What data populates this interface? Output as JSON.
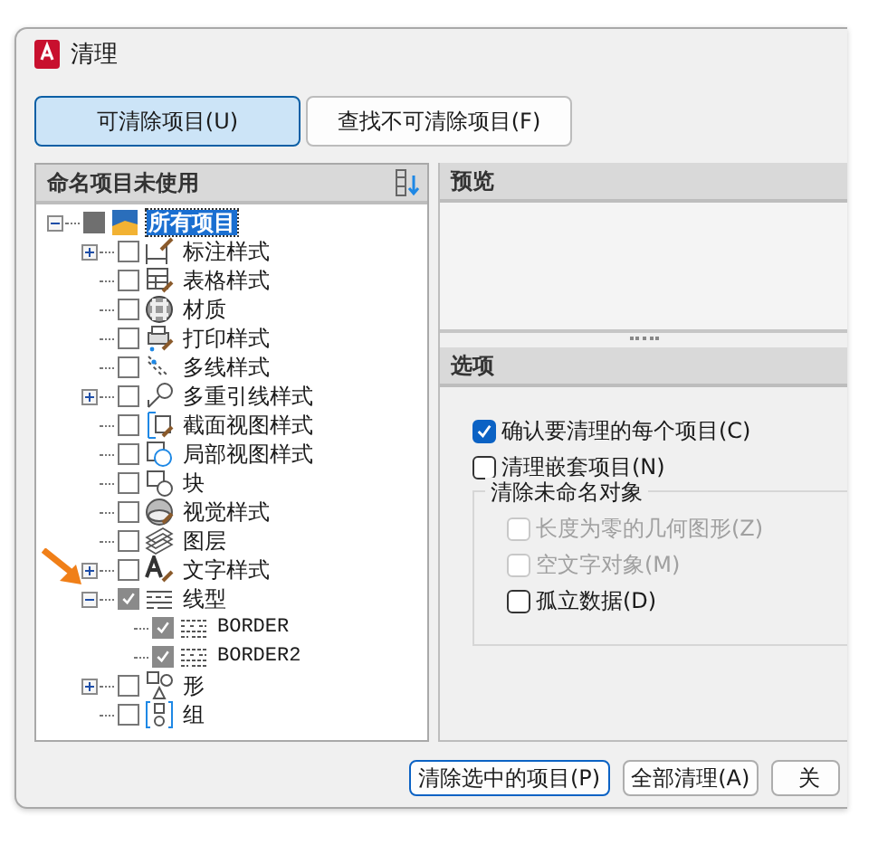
{
  "window": {
    "title": "清理"
  },
  "tabs": [
    {
      "label": "可清除项目(U)",
      "selected": true
    },
    {
      "label": "查找不可清除项目(F)",
      "selected": false
    }
  ],
  "tree": {
    "header": "命名项目未使用",
    "items": [
      {
        "label": "所有项目",
        "checked": false,
        "partial": true,
        "selected": true,
        "expanded": true,
        "children": [
          {
            "label": "标注样式",
            "checked": false,
            "selected": false,
            "expanded": false
          },
          {
            "label": "表格样式",
            "checked": false,
            "selected": false
          },
          {
            "label": "材质",
            "checked": false,
            "selected": false
          },
          {
            "label": "打印样式",
            "checked": false,
            "selected": false
          },
          {
            "label": "多线样式",
            "checked": false,
            "selected": false
          },
          {
            "label": "多重引线样式",
            "checked": false,
            "selected": false,
            "expanded": false
          },
          {
            "label": "截面视图样式",
            "checked": false,
            "selected": false
          },
          {
            "label": "局部视图样式",
            "checked": false,
            "selected": false
          },
          {
            "label": "块",
            "checked": false,
            "selected": false
          },
          {
            "label": "视觉样式",
            "checked": false,
            "selected": false
          },
          {
            "label": "图层",
            "checked": false,
            "selected": false
          },
          {
            "label": "文字样式",
            "checked": false,
            "selected": false,
            "expanded": false
          },
          {
            "label": "线型",
            "checked": true,
            "selected": false,
            "expanded": true,
            "children": [
              {
                "label": "BORDER",
                "checked": true,
                "selected": false
              },
              {
                "label": "BORDER2",
                "checked": true,
                "selected": false
              }
            ]
          },
          {
            "label": "形",
            "checked": false,
            "selected": false,
            "expanded": false
          },
          {
            "label": "组",
            "checked": false,
            "selected": false
          }
        ]
      }
    ]
  },
  "preview": {
    "header": "预览"
  },
  "options": {
    "header": "选项",
    "checks": [
      {
        "label": "确认要清理的每个项目(C)",
        "checked": true,
        "disabled": false
      },
      {
        "label": "清理嵌套项目(N)",
        "checked": false,
        "disabled": false
      }
    ],
    "group": {
      "title": "清除未命名对象",
      "checks": [
        {
          "label": "长度为零的几何图形(Z)",
          "checked": false,
          "disabled": true
        },
        {
          "label": "空文字对象(M)",
          "checked": false,
          "disabled": true
        },
        {
          "label": "孤立数据(D)",
          "checked": false,
          "disabled": false
        }
      ]
    }
  },
  "buttons": [
    {
      "label": "清除选中的项目(P)",
      "default": true
    },
    {
      "label": "全部清理(A)",
      "default": false
    },
    {
      "label": "关",
      "default": false
    }
  ]
}
